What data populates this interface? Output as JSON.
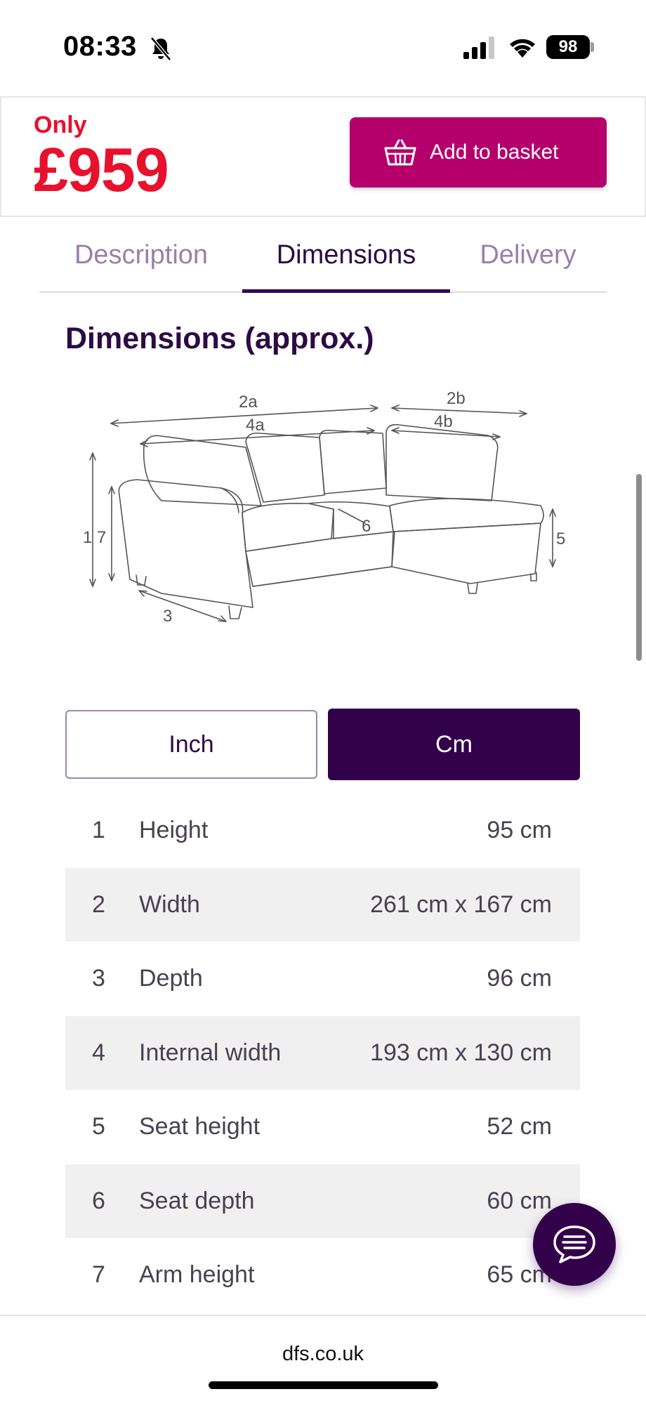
{
  "status": {
    "time": "08:33",
    "battery": "98",
    "icons": [
      "bell-muted-icon",
      "signal-icon",
      "wifi-icon",
      "battery-icon"
    ]
  },
  "price_bar": {
    "only": "Only",
    "price": "£959",
    "basket_label": "Add to basket",
    "basket_icon": "basket-icon"
  },
  "tabs": [
    {
      "label": "Description",
      "active": false
    },
    {
      "label": "Dimensions",
      "active": true
    },
    {
      "label": "Delivery",
      "active": false
    }
  ],
  "section_title": "Dimensions (approx.)",
  "diagram": {
    "labels": [
      "2a",
      "4a",
      "2b",
      "4b",
      "1",
      "7",
      "6",
      "5",
      "3"
    ]
  },
  "units": {
    "inch": "Inch",
    "cm": "Cm",
    "selected": "Cm"
  },
  "dimensions": [
    {
      "num": "1",
      "label": "Height",
      "value": "95 cm"
    },
    {
      "num": "2",
      "label": "Width",
      "value": "261 cm x 167 cm"
    },
    {
      "num": "3",
      "label": "Depth",
      "value": "96 cm"
    },
    {
      "num": "4",
      "label": "Internal width",
      "value": "193 cm x 130 cm"
    },
    {
      "num": "5",
      "label": "Seat height",
      "value": "52 cm"
    },
    {
      "num": "6",
      "label": "Seat depth",
      "value": "60 cm"
    },
    {
      "num": "7",
      "label": "Arm height",
      "value": "65 cm"
    }
  ],
  "chat_icon": "chat-icon",
  "footer": {
    "url": "dfs.co.uk"
  },
  "colors": {
    "brand_purple": "#33004a",
    "basket_magenta": "#b5006b",
    "price_red": "#e8112d"
  }
}
